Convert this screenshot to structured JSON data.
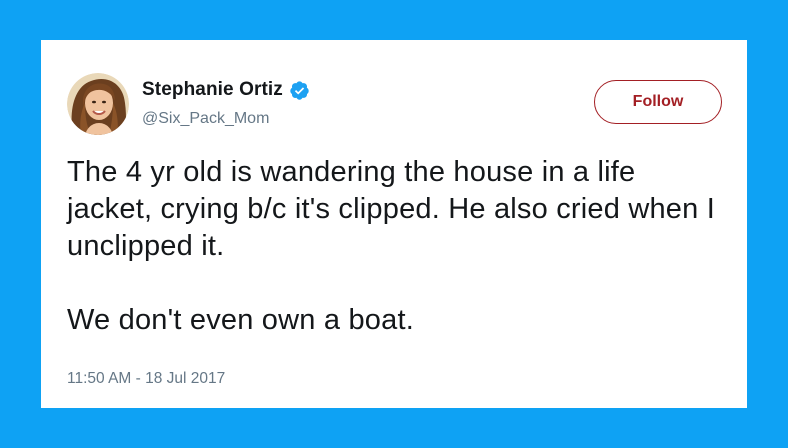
{
  "tweet": {
    "author": {
      "display_name": "Stephanie Ortiz",
      "handle": "@Six_Pack_Mom",
      "verified": true
    },
    "follow_label": "Follow",
    "text_paragraphs": [
      "The 4 yr old is wandering the house in a life jacket, crying b/c it's clipped. He also cried when I unclipped it.",
      "We don't even own a boat."
    ],
    "timestamp": "11:50 AM - 18 Jul 2017"
  },
  "icons": {
    "verified": "verified-badge-icon",
    "avatar": "profile-photo"
  },
  "colors": {
    "background": "#0ea2f4",
    "card": "#ffffff",
    "follow_accent": "#a31f24",
    "verified_blue": "#1da1f2",
    "secondary_text": "#657786",
    "primary_text": "#14171a"
  }
}
